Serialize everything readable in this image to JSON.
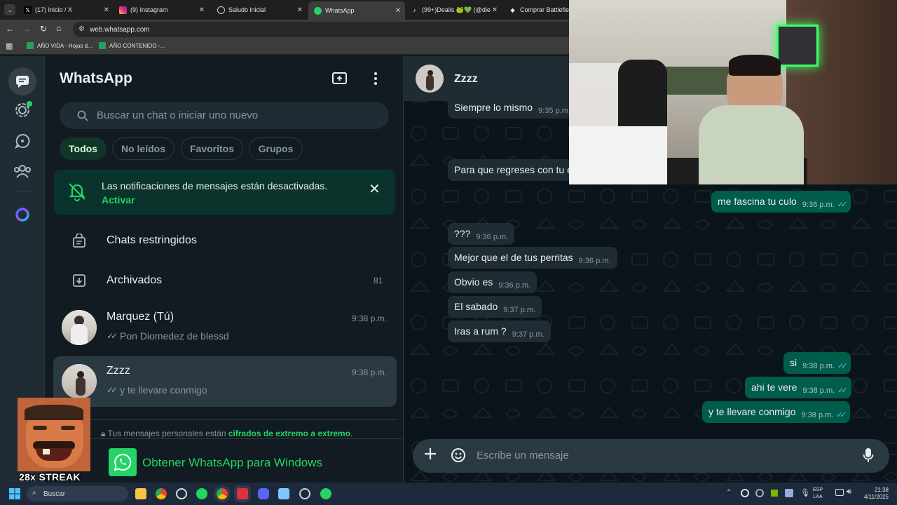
{
  "browser": {
    "tabs": [
      {
        "label": "(17) Inicio / X",
        "icon": "x-logo-icon"
      },
      {
        "label": "(9) Instagram",
        "icon": "instagram-icon"
      },
      {
        "label": "Saludo inicial",
        "icon": "openai-icon"
      },
      {
        "label": "WhatsApp",
        "icon": "whatsapp-icon",
        "active": true
      },
      {
        "label": "(99+)Dealis 🐸💚 (@die",
        "icon": "tiktok-icon"
      },
      {
        "label": "Comprar Battlefield",
        "icon": "ea-icon"
      }
    ],
    "url": "web.whatsapp.com",
    "bookmarks": [
      "AÑO VIDA - Hojas d...",
      "AÑO CONTENIDO -..."
    ]
  },
  "sidebar": {
    "title": "WhatsApp",
    "search_placeholder": "Buscar un chat o iniciar uno nuevo",
    "filters": [
      "Todos",
      "No leídos",
      "Favoritos",
      "Grupos"
    ],
    "notification": {
      "text": "Las notificaciones de mensajes están desactivadas.",
      "action": "Activar"
    },
    "restricted_label": "Chats restringidos",
    "archived_label": "Archivados",
    "archived_count": "81",
    "chats": [
      {
        "name": "Marquez (Tú)",
        "time": "9:38 p.m.",
        "preview": "Pon Diomedez de blessd"
      },
      {
        "name": "Zzzz",
        "time": "9:38 p.m.",
        "preview": "y te llevare conmigo"
      }
    ],
    "encryption_prefix": "Tus mensajes personales están",
    "encryption_link": "cifrados de extremo a extremo",
    "encryption_suffix": ".",
    "get_app": "Obtener WhatsApp para Windows"
  },
  "chat": {
    "contact": "Zzzz",
    "messages": [
      {
        "dir": "in",
        "text": "Siempre lo mismo",
        "time": "9:35 p.m."
      },
      {
        "dir": "in",
        "text": "Para que regreses con tu e",
        "time": ""
      },
      {
        "dir": "out",
        "text": "me fascina tu culo",
        "time": "9:36 p.m."
      },
      {
        "dir": "in",
        "text": "???",
        "time": "9:36 p.m."
      },
      {
        "dir": "in",
        "text": "Mejor que el de tus perritas",
        "time": "9:36 p.m."
      },
      {
        "dir": "in",
        "text": "Obvio es",
        "time": "9:36 p.m."
      },
      {
        "dir": "in",
        "text": "El sabado",
        "time": "9:37 p.m."
      },
      {
        "dir": "in",
        "text": "Iras a  rum ?",
        "time": "9:37 p.m."
      },
      {
        "dir": "out",
        "text": "si",
        "time": "9:38 p.m."
      },
      {
        "dir": "out",
        "text": "ahi te vere",
        "time": "9:38 p.m."
      },
      {
        "dir": "out",
        "text": "y te llevare conmigo",
        "time": "9:38 p.m."
      }
    ],
    "composer_placeholder": "Escribe un mensaje"
  },
  "overlay": {
    "streak": "28x STREAK"
  },
  "taskbar": {
    "search": "Buscar",
    "lang_top": "ESP",
    "lang_bottom": "LAA",
    "time": "21:38",
    "date": "4/11/2025"
  },
  "colors": {
    "accent": "#25d366",
    "panel": "#111b21",
    "header": "#202c33",
    "out_bubble": "#005c4b",
    "in_bubble": "#202c33",
    "read_ticks": "#53bdeb"
  }
}
